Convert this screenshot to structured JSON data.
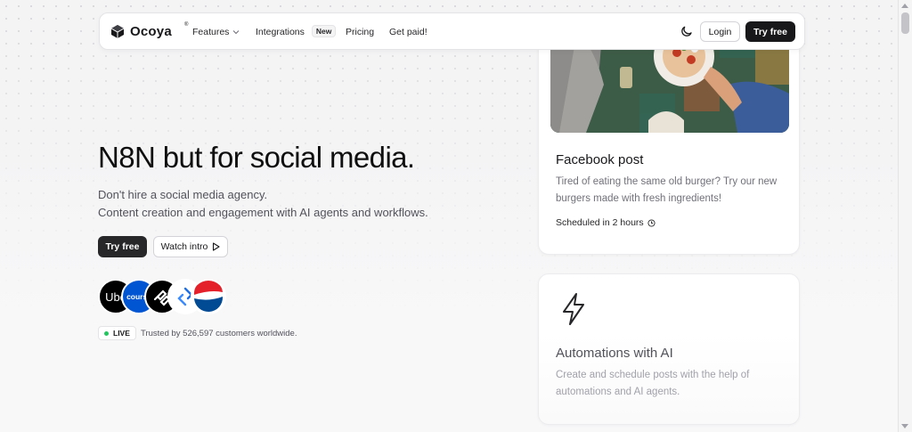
{
  "nav": {
    "logo_text": "Ocoya",
    "logo_mark": "®",
    "items": [
      {
        "label": "Features"
      },
      {
        "label": "Integrations",
        "badge": "New"
      },
      {
        "label": "Pricing"
      },
      {
        "label": "Get paid!"
      }
    ],
    "login_label": "Login",
    "try_free_label": "Try free"
  },
  "hero": {
    "title": "N8N but for social media.",
    "subtitle_line1": "Don't hire a social media agency.",
    "subtitle_line2": "Content creation and engagement with AI agents and workflows.",
    "try_free_label": "Try free",
    "watch_intro_label": "Watch intro",
    "customer_logos": [
      {
        "name": "Uber",
        "text": "Ube",
        "color": "#000000"
      },
      {
        "name": "Coursera",
        "text": "course",
        "color": "#0056d2"
      },
      {
        "name": "Squarespace",
        "text": "",
        "color": "#000000"
      },
      {
        "name": "Zapier-like",
        "text": "",
        "color": "#ffffff"
      },
      {
        "name": "Pepsi",
        "text": "",
        "color": "#ffffff"
      }
    ],
    "live_label": "LIVE",
    "trusted_text": "Trusted by 526,597 customers worldwide."
  },
  "facebook_card": {
    "title": "Facebook post",
    "body": "Tired of eating the same old burger? Try our new burgers made with fresh ingredients!",
    "scheduled": "Scheduled in 2 hours"
  },
  "automation_card": {
    "title": "Automations with AI",
    "body": "Create and schedule posts with the help of automations and AI agents."
  },
  "colors": {
    "dark": "#18181b",
    "live_green": "#22c55e",
    "muted": "#71717a"
  }
}
